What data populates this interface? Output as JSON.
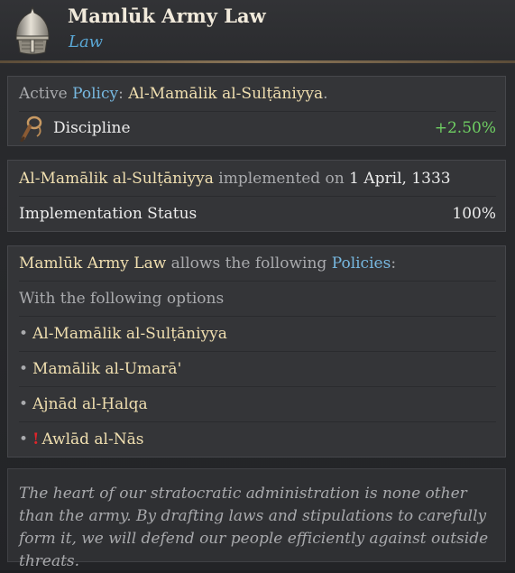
{
  "header": {
    "title": "Mamlūk Army Law",
    "subtitle": "Law",
    "icon": "helmet-icon"
  },
  "active_policy": {
    "prefix": "Active",
    "policy_word": "Policy",
    "colon": ":",
    "name": "Al-Mamālik al-Sulṭāniyya",
    "period": ".",
    "effect": {
      "icon": "whip-icon",
      "label": "Discipline",
      "value": "+2.50%"
    }
  },
  "implementation": {
    "policy_name": "Al-Mamālik al-Sulṭāniyya",
    "middle_text": "implemented on",
    "date": "1 April, 1333",
    "status_label": "Implementation Status",
    "status_value": "100%"
  },
  "policies": {
    "law_name": "Mamlūk Army Law",
    "middle_text": "allows the following",
    "policies_word": "Policies",
    "colon": ":",
    "options_heading": "With the following options",
    "bullet": "•",
    "warning_mark": "!",
    "items": [
      "Al-Mamālik al-Sulṭāniyya",
      "Mamālik al-Umarā'",
      "Ajnād al-Ḥalqa",
      "Awlād al-Nās"
    ]
  },
  "flavor_text": "The heart of our stratocratic administration is none other than the army. By drafting laws and stipulations to carefully form it, we will defend our people efficiently against outside threats.",
  "colors": {
    "accent_blue": "#77b8e0",
    "gold_text": "#f0dfb0",
    "positive_green": "#6fcf63",
    "warning_red": "#e0242a"
  }
}
